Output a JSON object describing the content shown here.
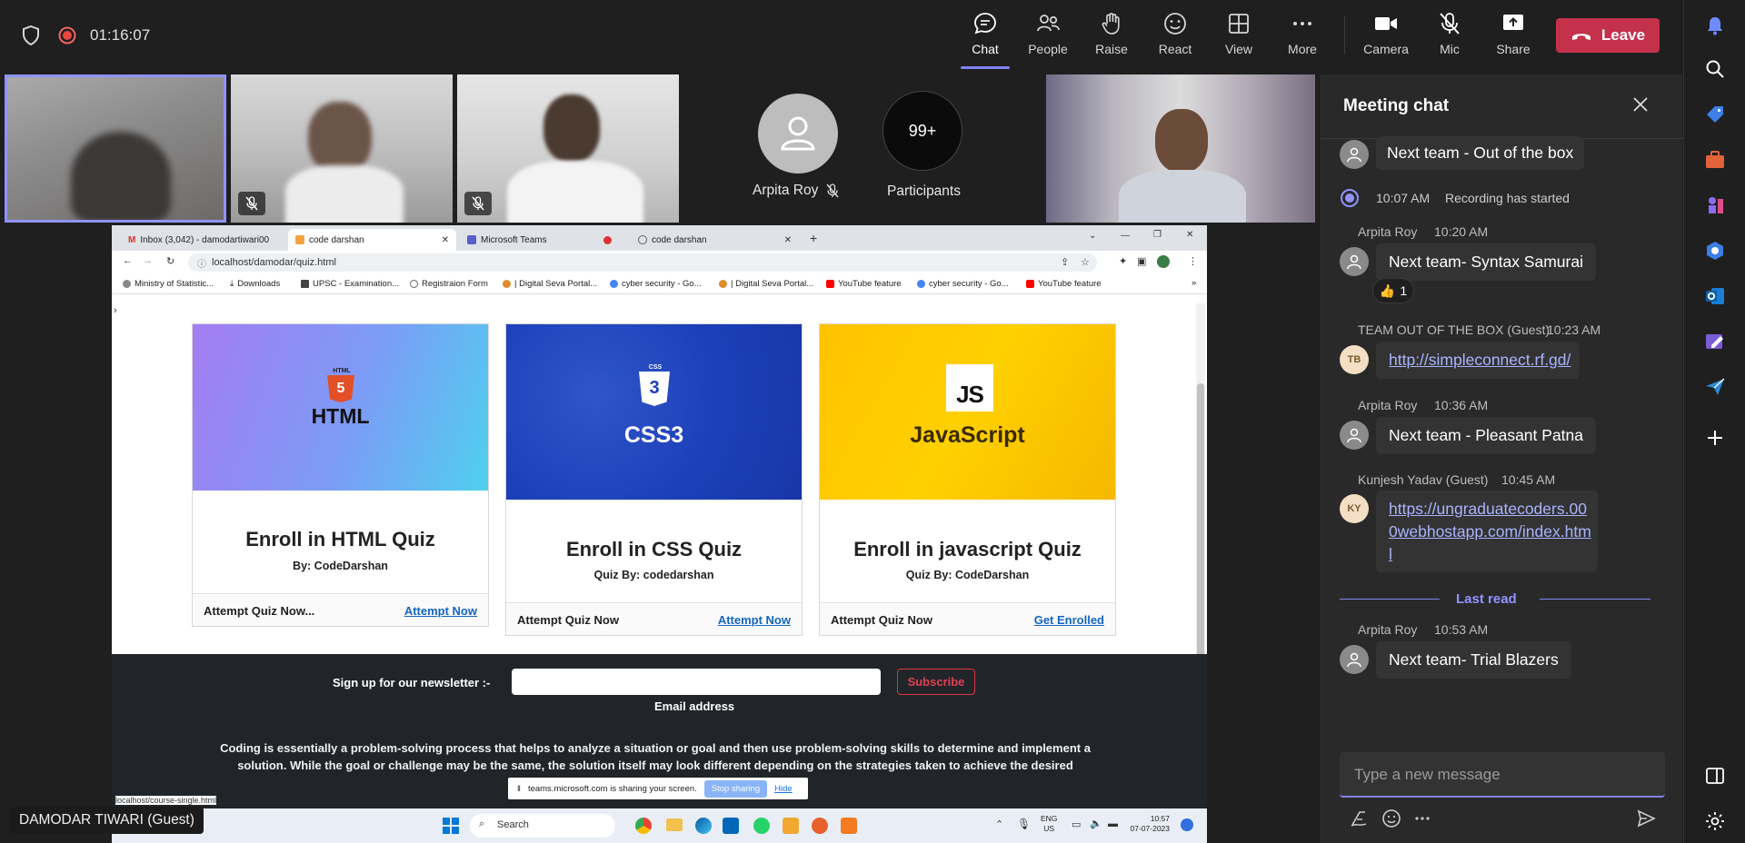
{
  "meeting": {
    "timer": "01:16:07",
    "controls": {
      "chat": "Chat",
      "people": "People",
      "raise": "Raise",
      "react": "React",
      "view": "View",
      "more": "More",
      "camera": "Camera",
      "mic": "Mic",
      "share": "Share",
      "leave": "Leave"
    },
    "participants": {
      "arpita_name": "Arpita Roy",
      "count": "99+",
      "count_label": "Participants"
    },
    "self_name": "DAMODAR TIWARI (Guest)"
  },
  "browser": {
    "tabs": [
      "Inbox (3,042) - damodartiwari00",
      "code darshan",
      "Microsoft Teams",
      "code darshan"
    ],
    "url": "localhost/damodar/quiz.html",
    "bookmarks": [
      "Ministry of Statistic...",
      "Downloads",
      "UPSC - Examination...",
      "Registraion Form",
      "| Digital Seva Portal...",
      "cyber security - Go...",
      "| Digital Seva Portal...",
      "YouTube feature",
      "cyber security - Go...",
      "YouTube feature"
    ],
    "status_url": "localhost/course-single.html",
    "sharing_text": "teams.microsoft.com is sharing your screen.",
    "stop_sharing": "Stop sharing",
    "hide": "Hide"
  },
  "page": {
    "cards": [
      {
        "logo_top": "HTML",
        "logo_badge": "5",
        "logo_text": "HTML",
        "title": "Enroll in HTML Quiz",
        "by": "By: CodeDarshan",
        "foot_left": "Attempt Quiz Now...",
        "foot_right": "Attempt Now"
      },
      {
        "logo_top": "CSS",
        "logo_badge": "3",
        "logo_text": "CSS3",
        "title": "Enroll in CSS Quiz",
        "by": "Quiz By: codedarshan",
        "foot_left": "Attempt Quiz Now",
        "foot_right": "Attempt Now"
      },
      {
        "logo_top": "",
        "logo_badge": "JS",
        "logo_text": "JavaScript",
        "title": "Enroll in javascript Quiz",
        "by": "Quiz By: CodeDarshan",
        "foot_left": "Attempt Quiz Now",
        "foot_right": "Get Enrolled"
      }
    ],
    "newsletter_label": "Sign up for our newsletter :-",
    "email_label": "Email address",
    "subscribe": "Subscribe",
    "paragraph": "Coding is essentially a problem-solving process that helps to analyze a situation or goal and then use problem-solving skills to determine and implement a solution. While the goal or challenge may be the same, the solution itself may look different depending on the strategies taken to achieve the desired"
  },
  "taskbar": {
    "search": "Search",
    "lang1": "ENG",
    "lang2": "US",
    "time": "10:57",
    "date": "07-07-2023"
  },
  "chat": {
    "title": "Meeting chat",
    "messages": {
      "m1_text": "Next team - Out of the box",
      "rec_time": "10:07 AM",
      "rec_text": "Recording has started",
      "m2_author": "Arpita Roy",
      "m2_time": "10:20 AM",
      "m2_text": "Next team- Syntax Samurai",
      "m2_reaction": "1",
      "m3_author": "TEAM OUT OF THE BOX (Guest)",
      "m3_time": "10:23 AM",
      "m3_initials": "TB",
      "m3_link": "http://simpleconnect.rf.gd/",
      "m4_author": "Arpita Roy",
      "m4_time": "10:36 AM",
      "m4_text": "Next team - Pleasant Patna",
      "m5_author": "Kunjesh Yadav (Guest)",
      "m5_time": "10:45 AM",
      "m5_initials": "KY",
      "m5_link_l1": "https://ungraduatecoders.00",
      "m5_link_l2": "0webhostapp.com/index.htm",
      "m5_link_l3": "l",
      "last_read": "Last read",
      "m6_author": "Arpita Roy",
      "m6_time": "10:53 AM",
      "m6_text": "Next team- Trial Blazers"
    },
    "input_placeholder": "Type a new message"
  }
}
